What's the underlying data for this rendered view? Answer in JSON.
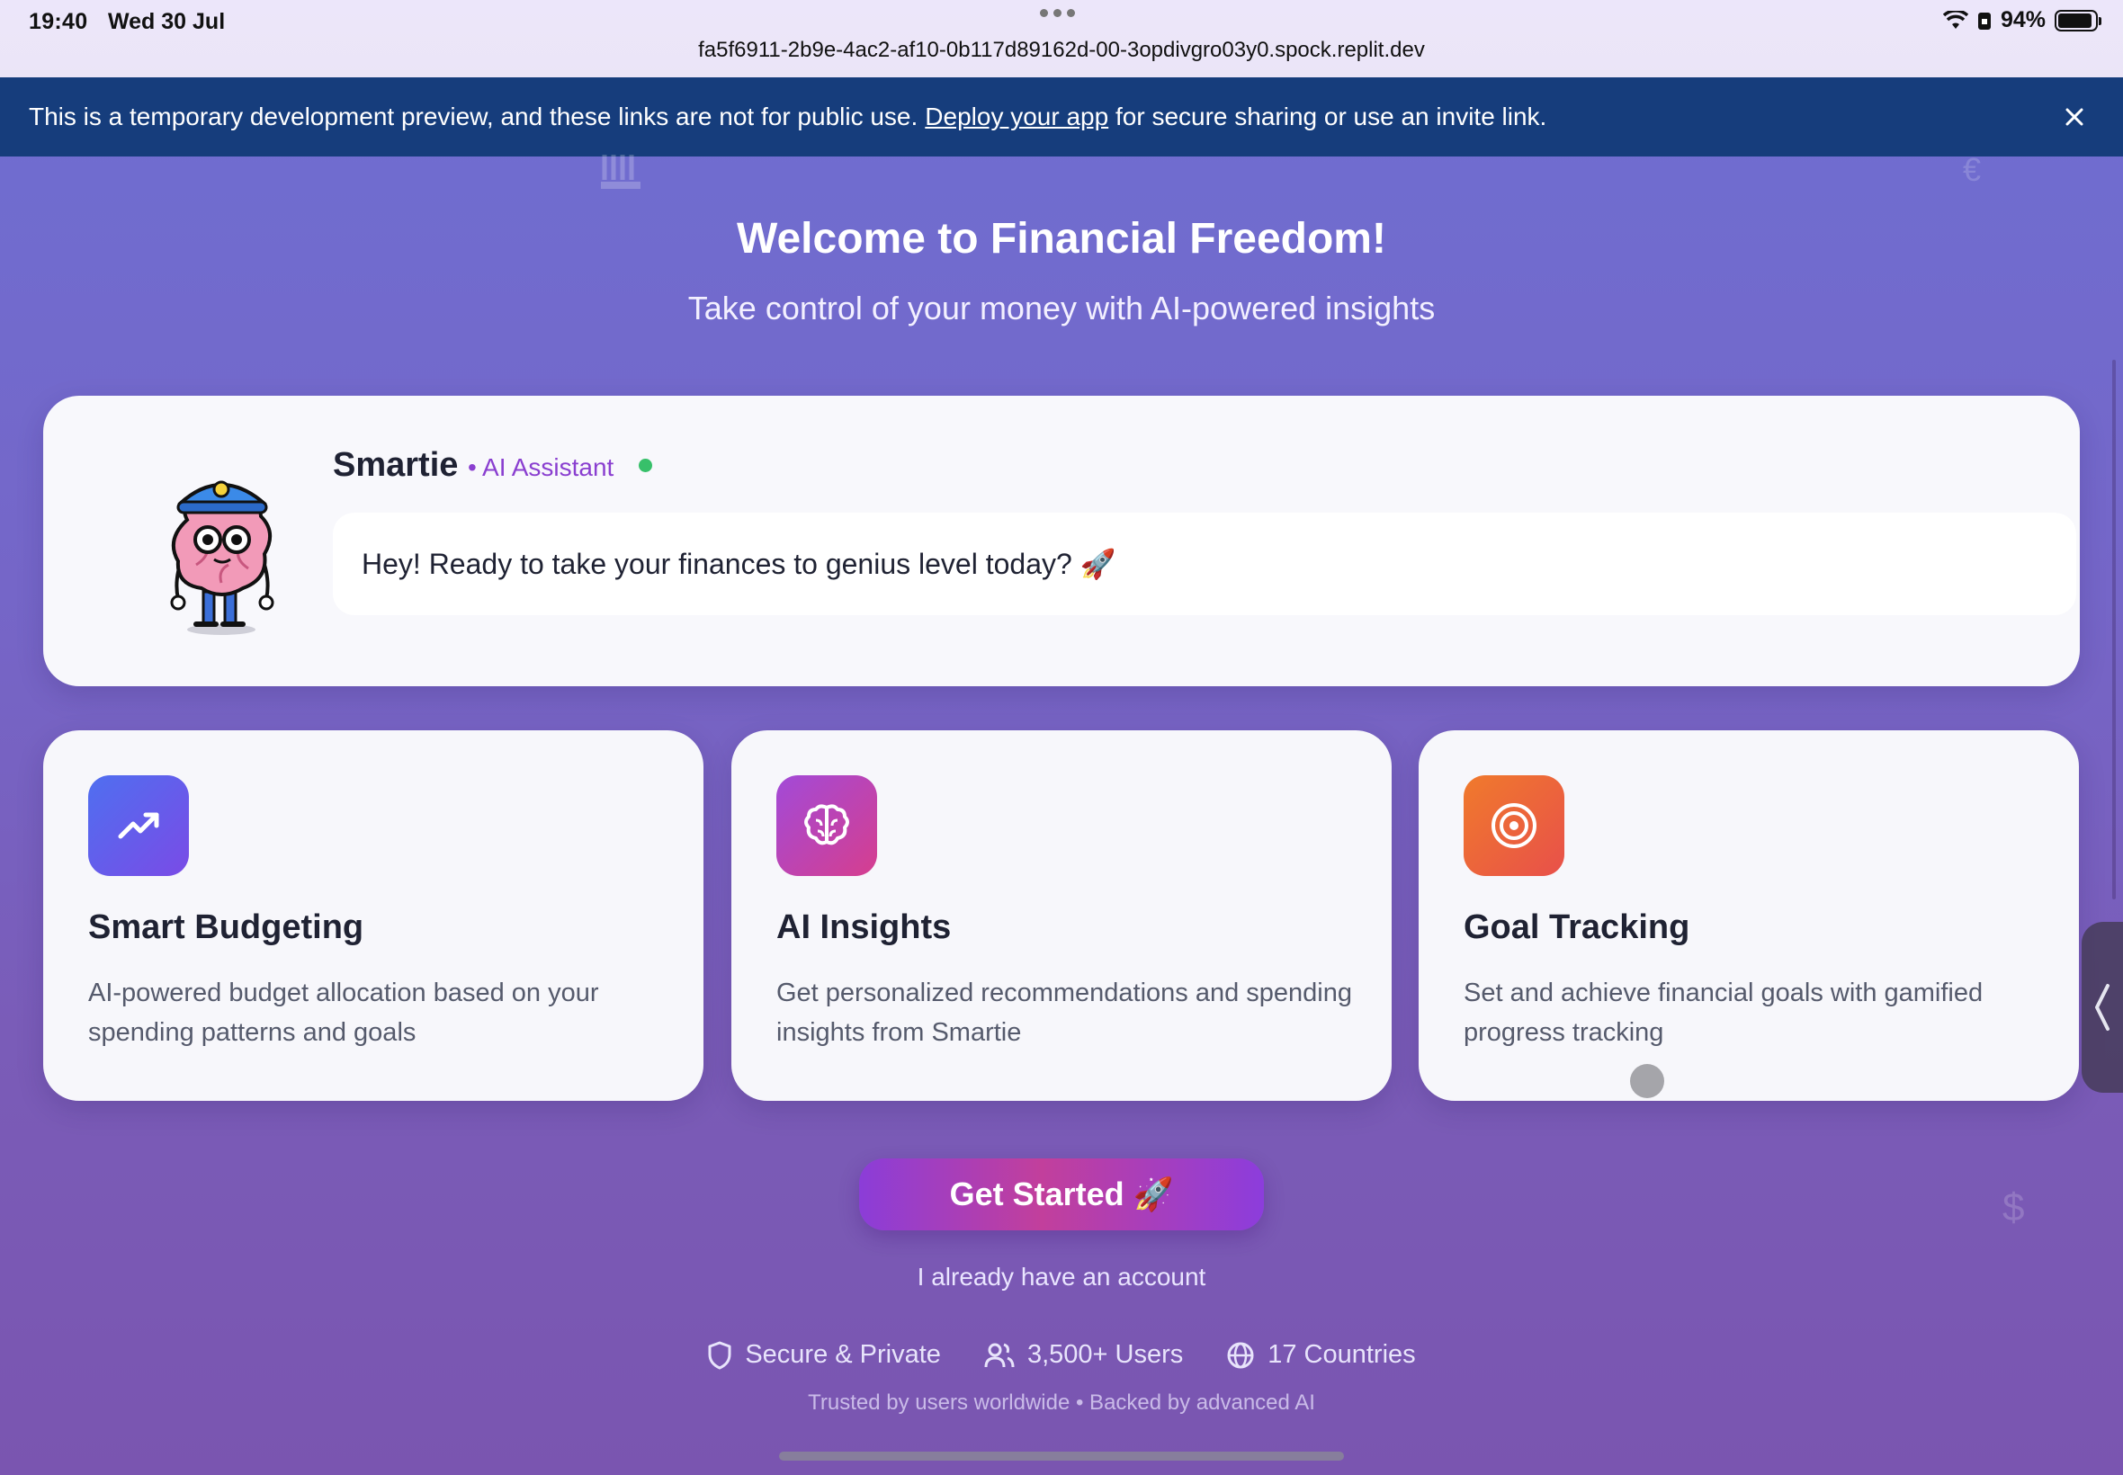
{
  "status_bar": {
    "time": "19:40",
    "date": "Wed 30 Jul",
    "battery": "94%",
    "url": "fa5f6911-2b9e-4ac2-af10-0b117d89162d-00-3opdivgro03y0.spock.replit.dev"
  },
  "dev_banner": {
    "text_before": "This is a temporary development preview, and these links are not for public use. ",
    "link": "Deploy your app",
    "text_after": " for secure sharing or use an invite link."
  },
  "hero": {
    "title": "Welcome to Financial Freedom!",
    "subtitle": "Take control of your money with AI-powered insights"
  },
  "assistant": {
    "name": "Smartie",
    "role": "• AI Assistant",
    "message": "Hey! Ready to take your finances to genius level today? 🚀"
  },
  "features": [
    {
      "title": "Smart Budgeting",
      "description": "AI-powered budget allocation based on your spending patterns and goals",
      "icon": "trending-up-icon"
    },
    {
      "title": "AI Insights",
      "description": "Get personalized recommendations and spending insights from Smartie",
      "icon": "brain-icon"
    },
    {
      "title": "Goal Tracking",
      "description": "Set and achieve financial goals with gamified progress tracking",
      "icon": "target-icon"
    }
  ],
  "cta": {
    "primary": "Get Started 🚀",
    "secondary": "I already have an account"
  },
  "trust": {
    "secure": "Secure & Private",
    "users": "3,500+ Users",
    "countries": "17 Countries",
    "footnote": "Trusted by users worldwide • Backed by advanced AI"
  },
  "colors": {
    "banner": "#163d7c",
    "accent_purple": "#8a3fd0",
    "online": "#37c06a",
    "budget_icon": "#5b5ce8",
    "insights_icon": "#c043c8",
    "goal_icon": "#ef6a3a"
  }
}
